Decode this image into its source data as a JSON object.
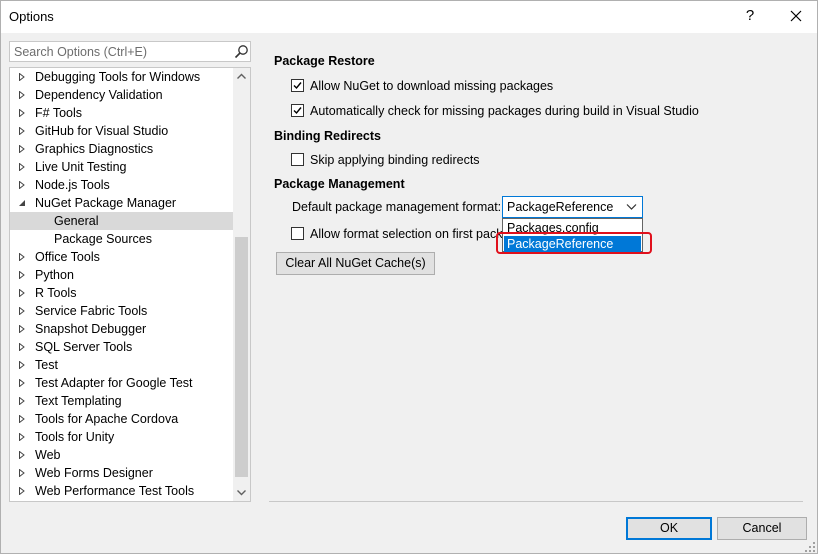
{
  "window": {
    "title": "Options",
    "help_label": "?"
  },
  "search": {
    "placeholder": "Search Options (Ctrl+E)"
  },
  "tree": {
    "items": [
      {
        "label": "Debugging Tools for Windows",
        "expanded": false
      },
      {
        "label": "Dependency Validation",
        "expanded": false
      },
      {
        "label": "F# Tools",
        "expanded": false
      },
      {
        "label": "GitHub for Visual Studio",
        "expanded": false
      },
      {
        "label": "Graphics Diagnostics",
        "expanded": false
      },
      {
        "label": "Live Unit Testing",
        "expanded": false
      },
      {
        "label": "Node.js Tools",
        "expanded": false
      },
      {
        "label": "NuGet Package Manager",
        "expanded": true
      },
      {
        "label": "General",
        "child": true,
        "selected": true
      },
      {
        "label": "Package Sources",
        "child": true
      },
      {
        "label": "Office Tools",
        "expanded": false
      },
      {
        "label": "Python",
        "expanded": false
      },
      {
        "label": "R Tools",
        "expanded": false
      },
      {
        "label": "Service Fabric Tools",
        "expanded": false
      },
      {
        "label": "Snapshot Debugger",
        "expanded": false
      },
      {
        "label": "SQL Server Tools",
        "expanded": false
      },
      {
        "label": "Test",
        "expanded": false
      },
      {
        "label": "Test Adapter for Google Test",
        "expanded": false
      },
      {
        "label": "Text Templating",
        "expanded": false
      },
      {
        "label": "Tools for Apache Cordova",
        "expanded": false
      },
      {
        "label": "Tools for Unity",
        "expanded": false
      },
      {
        "label": "Web",
        "expanded": false
      },
      {
        "label": "Web Forms Designer",
        "expanded": false
      },
      {
        "label": "Web Performance Test Tools",
        "expanded": false
      }
    ]
  },
  "package_restore": {
    "heading": "Package Restore",
    "allow_download": {
      "label": "Allow NuGet to download missing packages",
      "checked": true
    },
    "auto_check": {
      "label": "Automatically check for missing packages during build in Visual Studio",
      "checked": true
    }
  },
  "binding_redirects": {
    "heading": "Binding Redirects",
    "skip": {
      "label": "Skip applying binding redirects",
      "checked": false
    }
  },
  "package_management": {
    "heading": "Package Management",
    "format_label": "Default package management format:",
    "format_value": "PackageReference",
    "options": [
      "Packages.config",
      "PackageReference"
    ],
    "allow_format": {
      "label": "Allow format selection on first packa",
      "checked": false
    },
    "clear_cache_label": "Clear All NuGet Cache(s)"
  },
  "footer": {
    "ok_label": "OK",
    "cancel_label": "Cancel"
  },
  "colors": {
    "accent": "#0078d7",
    "highlight_ring": "#e0101c",
    "selected_tree_bg": "#d9d9d9"
  }
}
